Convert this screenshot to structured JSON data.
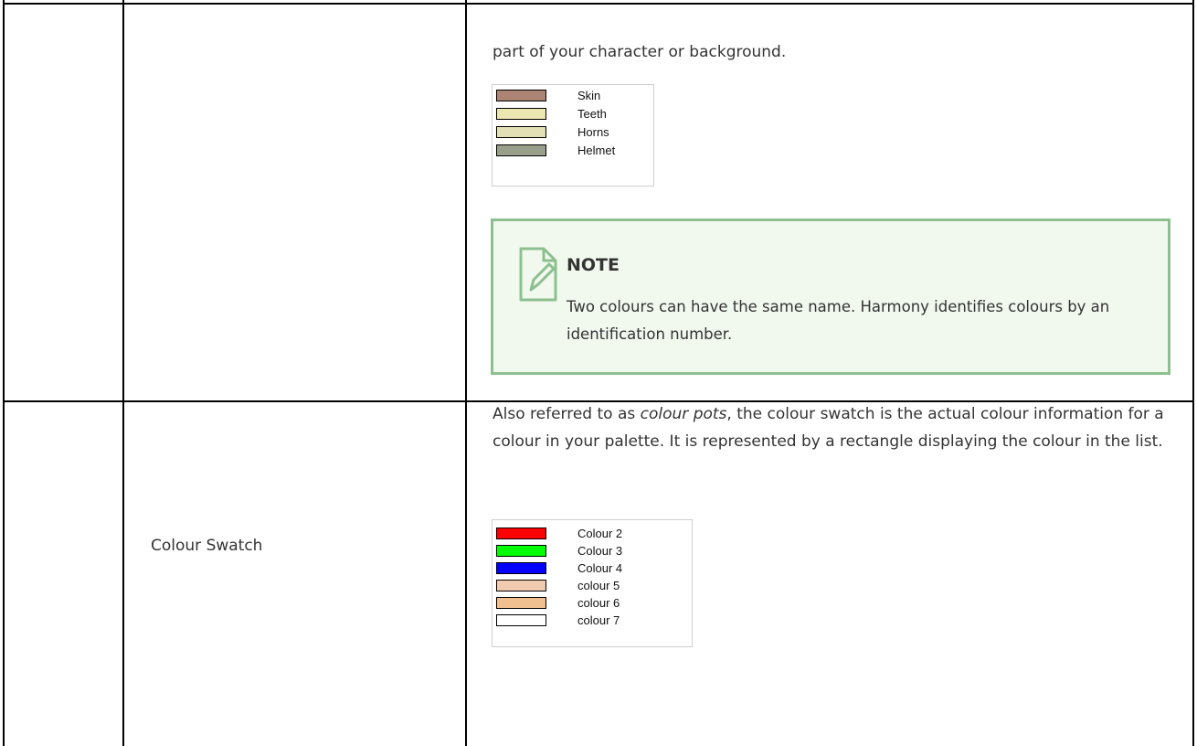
{
  "top_row": {
    "text": "part of your character or background.",
    "palette": [
      {
        "label": "Skin",
        "color": "#ac8474"
      },
      {
        "label": "Teeth",
        "color": "#ece7b0"
      },
      {
        "label": "Horns",
        "color": "#e2e0b4"
      },
      {
        "label": "Helmet",
        "color": "#98a08b"
      }
    ],
    "note": {
      "title": "NOTE",
      "text": "Two colours can have the same name. Harmony identifies colours by an identification number.",
      "icon": "note-pencil-icon"
    }
  },
  "bottom_row": {
    "label": "Colour Swatch",
    "desc_before": "Also referred to as ",
    "desc_italic": "colour pots",
    "desc_after": ", the colour swatch is the actual colour information for a colour in your palette. It is represented by a rectangle displaying the colour in the list.",
    "palette": [
      {
        "label": "Colour 2",
        "color": "#ff0000"
      },
      {
        "label": "Colour 3",
        "color": "#00ff00"
      },
      {
        "label": "Colour 4",
        "color": "#0000ff"
      },
      {
        "label": "colour 5",
        "color": "#f2ccb0"
      },
      {
        "label": "colour 6",
        "color": "#f0c090"
      },
      {
        "label": "colour 7",
        "color": "#ffffff"
      }
    ]
  }
}
